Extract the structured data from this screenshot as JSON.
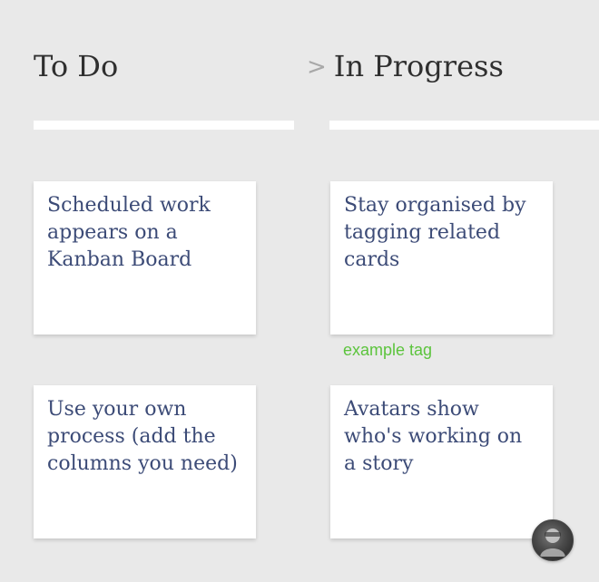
{
  "columns": [
    {
      "title": "To Do"
    },
    {
      "title": "In Progress",
      "chevron": ">"
    }
  ],
  "cards": [
    {
      "text": "Scheduled work appears on a Kanban Board"
    },
    {
      "text": "Stay organised by tagging related cards",
      "tag": "example tag"
    },
    {
      "text": "Use your own process (add the columns you need)"
    },
    {
      "text": "Avatars show who's working on a story",
      "avatar_icon": "user-avatar-icon"
    }
  ],
  "colors": {
    "background": "#e9e9e9",
    "card_text": "#3c4b77",
    "tag_text": "#5cc43d",
    "heading_text": "#2f2f2f"
  }
}
